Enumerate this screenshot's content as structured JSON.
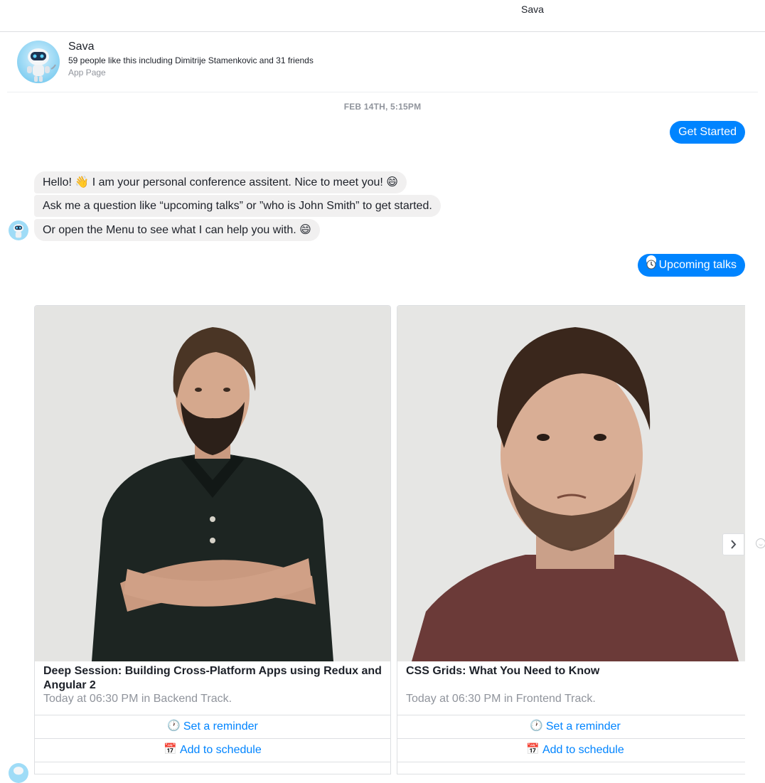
{
  "topbar": {
    "title": "Sava"
  },
  "page": {
    "name": "Sava",
    "likes": "59 people like this including Dimitrije Stamenkovic and 31 friends",
    "type": "App Page",
    "avatar_icon": "robot-icon"
  },
  "timestamp": "FEB 14TH, 5:15PM",
  "outgoing": {
    "get_started": "Get Started",
    "upcoming_talks": "Upcoming talks",
    "upcoming_talks_icon": "clock-emoji"
  },
  "messages": [
    {
      "text": "Hello! 👋 I am your personal conference assitent. Nice to meet you! 😄"
    },
    {
      "text": "Ask me a question like “upcoming talks” or ”who is John Smith” to get started."
    },
    {
      "text": "Or open the Menu to see what I can help you with. 😄"
    }
  ],
  "cards": [
    {
      "title": "Deep Session: Building Cross-Platform Apps using Redux and Angular 2",
      "subtitle": "Today at 06:30 PM in Backend Track.",
      "photo": "speaker-photo-long-hair-black-polo",
      "buttons": [
        {
          "label": "Set a reminder",
          "icon": "🕐"
        },
        {
          "label": "Add to schedule",
          "icon": "📅"
        }
      ]
    },
    {
      "title": "CSS Grids: What You Need to Know",
      "subtitle": "Today at 06:30 PM in Frontend Track.",
      "photo": "speaker-photo-short-hair-maroon-tee",
      "buttons": [
        {
          "label": "Set a reminder",
          "icon": "🕐"
        },
        {
          "label": "Add to schedule",
          "icon": "📅"
        }
      ]
    }
  ],
  "colors": {
    "messenger_blue": "#0084ff",
    "bubble_gray": "#f1f0f0",
    "meta_gray": "#90949c",
    "border": "#dddfe2"
  }
}
